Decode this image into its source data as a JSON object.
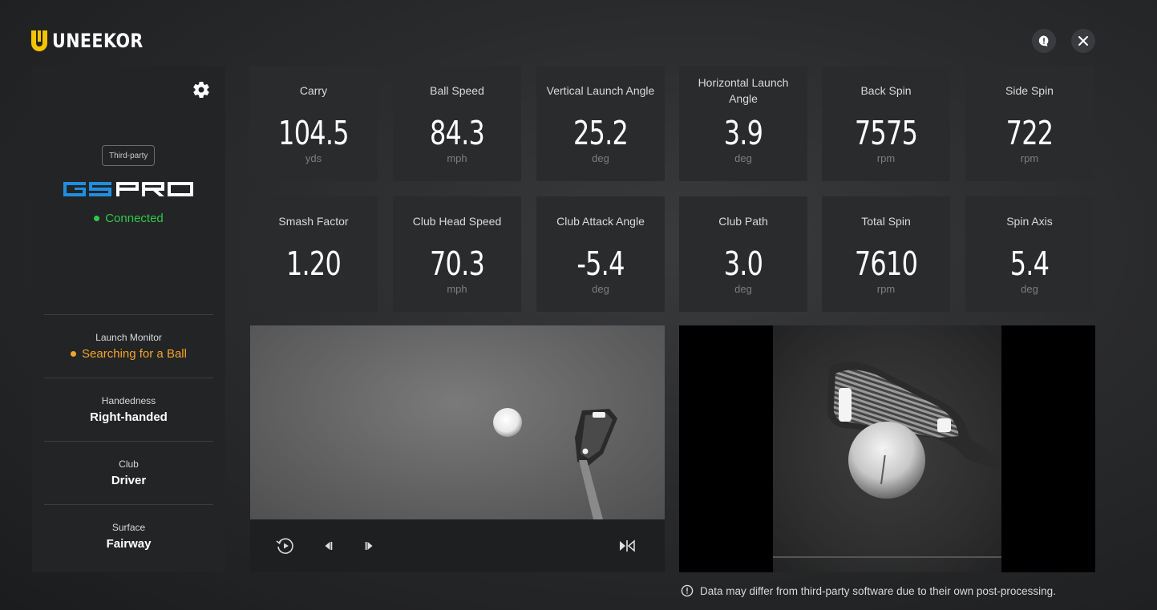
{
  "header": {
    "brand": "UNEEKOR"
  },
  "sidebar": {
    "badge": "Third-party",
    "software": "GSPRO",
    "connection_status": "Connected",
    "sections": [
      {
        "label": "Launch Monitor",
        "value": "Searching for a Ball"
      },
      {
        "label": "Handedness",
        "value": "Right-handed"
      },
      {
        "label": "Club",
        "value": "Driver"
      },
      {
        "label": "Surface",
        "value": "Fairway"
      }
    ]
  },
  "metrics": [
    {
      "label": "Carry",
      "value": "104.5",
      "unit": "yds"
    },
    {
      "label": "Ball Speed",
      "value": "84.3",
      "unit": "mph"
    },
    {
      "label": "Vertical Launch Angle",
      "value": "25.2",
      "unit": "deg"
    },
    {
      "label": "Horizontal Launch Angle",
      "value": "3.9",
      "unit": "deg"
    },
    {
      "label": "Back Spin",
      "value": "7575",
      "unit": "rpm"
    },
    {
      "label": "Side Spin",
      "value": "722",
      "unit": "rpm"
    },
    {
      "label": "Smash Factor",
      "value": "1.20",
      "unit": ""
    },
    {
      "label": "Club Head Speed",
      "value": "70.3",
      "unit": "mph"
    },
    {
      "label": "Club Attack Angle",
      "value": "-5.4",
      "unit": "deg"
    },
    {
      "label": "Club Path",
      "value": "3.0",
      "unit": "deg"
    },
    {
      "label": "Total Spin",
      "value": "7610",
      "unit": "rpm"
    },
    {
      "label": "Spin Axis",
      "value": "5.4",
      "unit": "deg"
    }
  ],
  "disclaimer": "Data may differ from third-party software due to their own post-processing.",
  "colors": {
    "brand_yellow": "#f5c400",
    "gspro_blue": "#1f8fe0",
    "connected_green": "#2ec94a",
    "searching_orange": "#f3a52b"
  },
  "icons": [
    "feedback-icon",
    "close-icon",
    "gear-icon",
    "replay-icon",
    "step-back-icon",
    "step-forward-icon",
    "flip-horizontal-icon",
    "info-icon"
  ]
}
